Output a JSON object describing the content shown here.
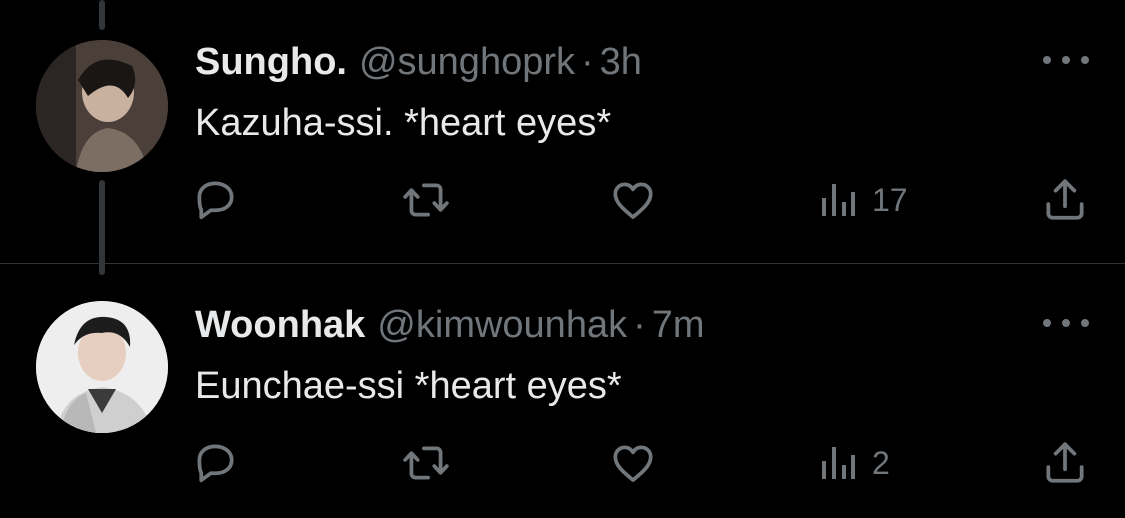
{
  "tweets": [
    {
      "name": "Sungho.",
      "handle": "@sunghoprk",
      "separator": "·",
      "time": "3h",
      "text": "Kazuha-ssi. *heart eyes*",
      "views": "17"
    },
    {
      "name": "Woonhak",
      "handle": "@kimwounhak",
      "separator": "·",
      "time": "7m",
      "text": "Eunchae-ssi *heart eyes*",
      "views": "2"
    }
  ],
  "icons": {
    "reply": "reply-icon",
    "retweet": "retweet-icon",
    "like": "heart-icon",
    "views": "views-icon",
    "share": "share-icon",
    "more": "more-icon"
  },
  "colors": {
    "background": "#000000",
    "text": "#e7e9ea",
    "secondary": "#71767b",
    "divider": "#2f3336"
  }
}
